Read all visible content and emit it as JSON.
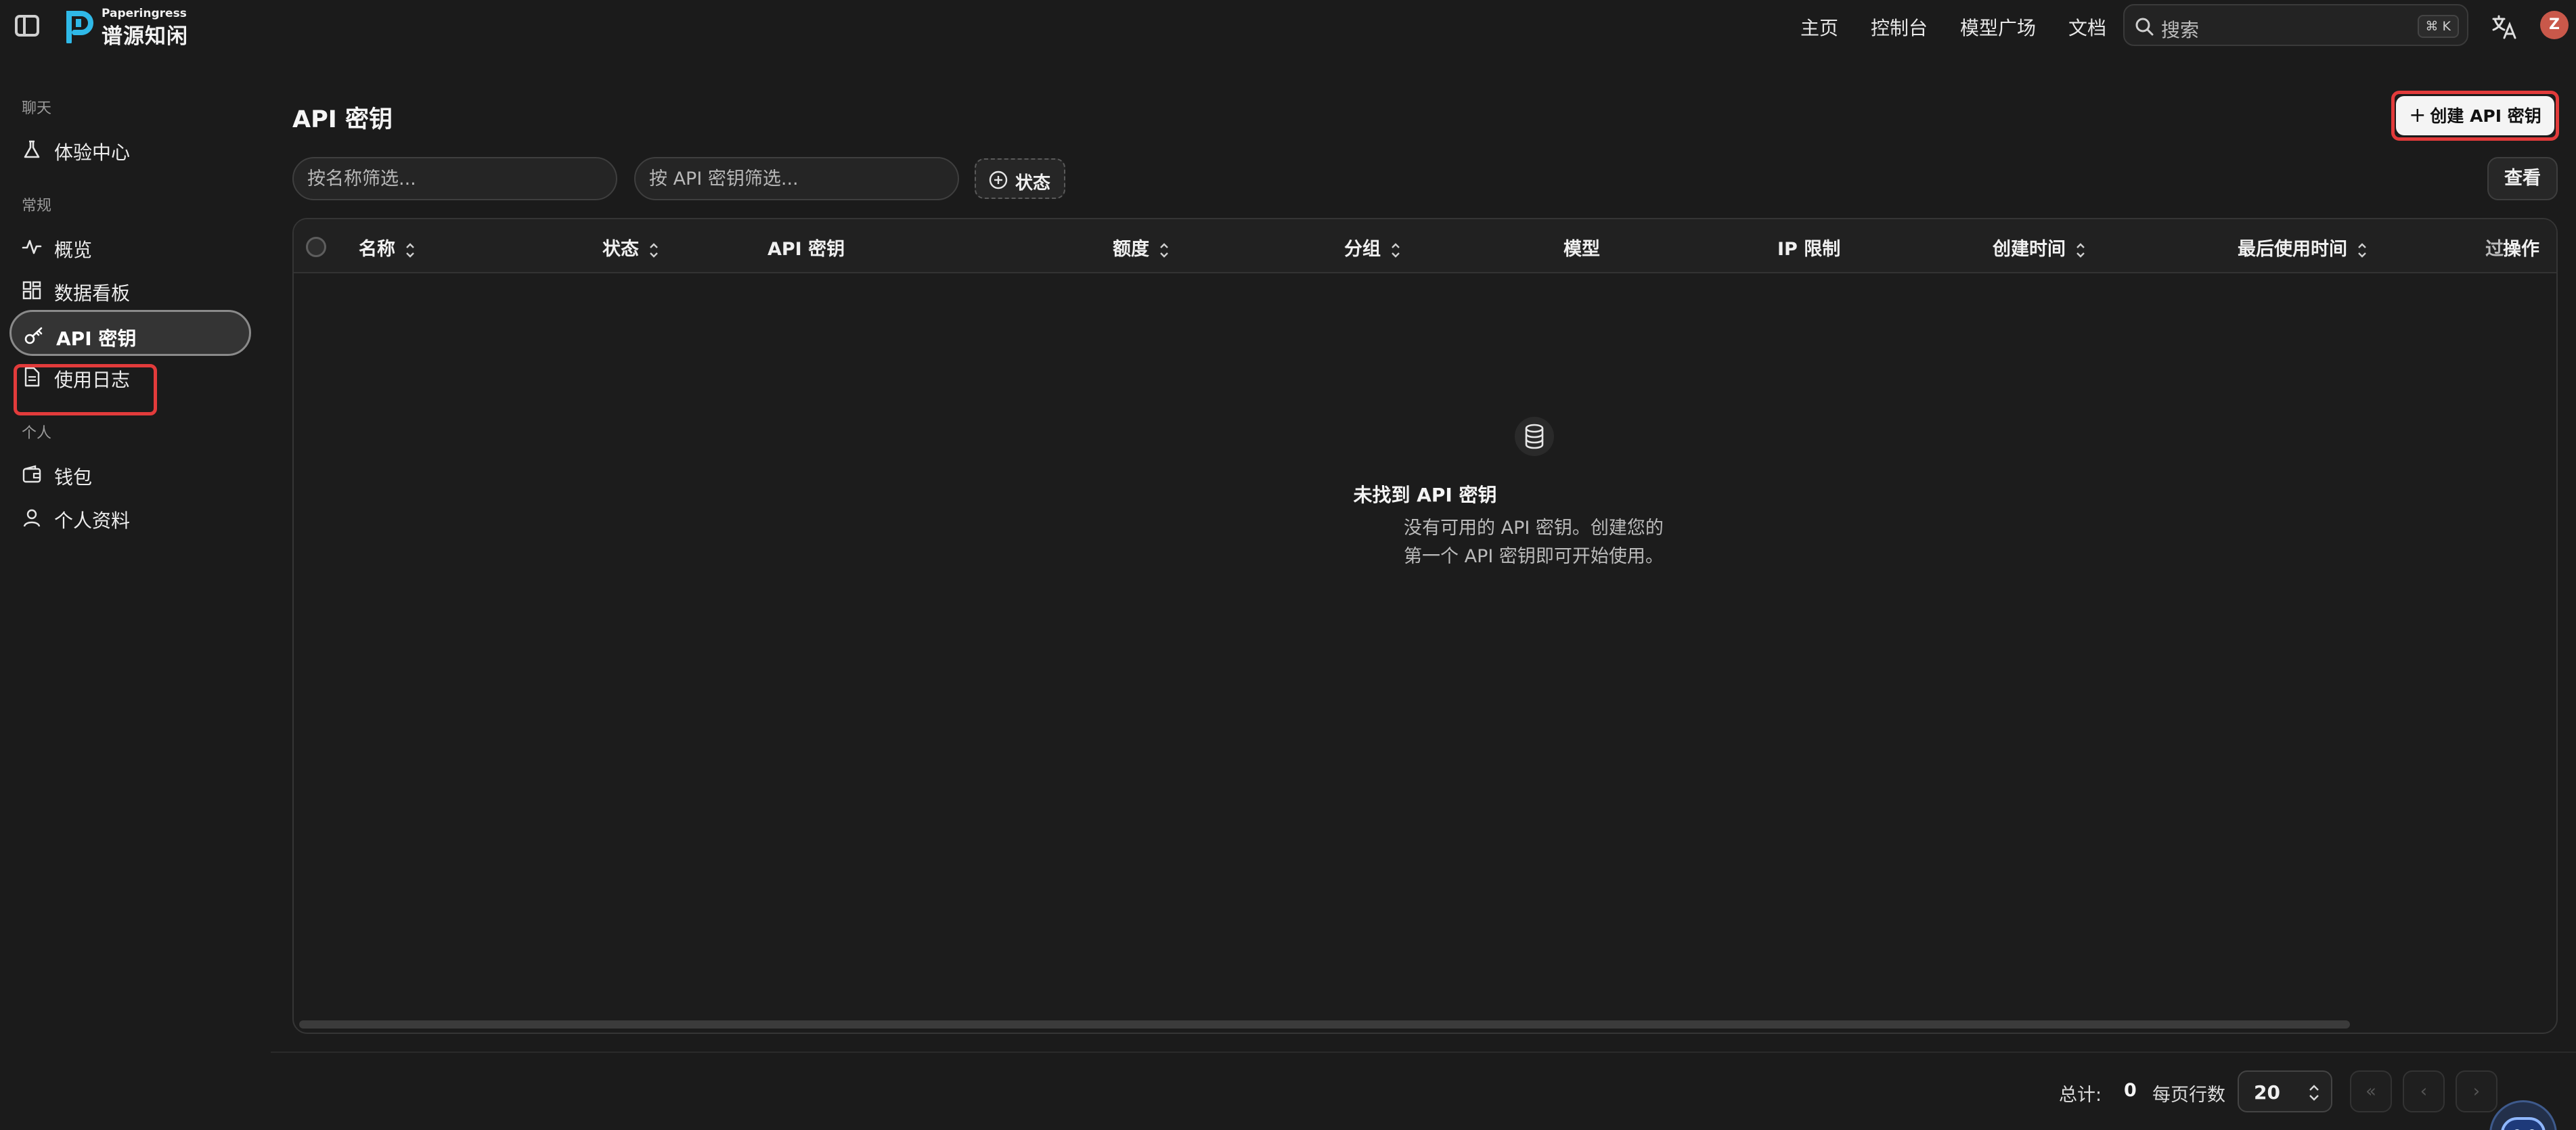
{
  "brand": {
    "small": "Paperingress",
    "name": "谱源知闲",
    "accent": "#2fb9e8"
  },
  "nav": {
    "home": "主页",
    "console": "控制台",
    "models": "模型广场",
    "docs": "文档"
  },
  "search": {
    "placeholder": "搜索",
    "shortcut": "⌘ K"
  },
  "user": {
    "avatar_letter": "Z",
    "avatar_color": "#c9584a"
  },
  "sidebar": {
    "sections": [
      {
        "title": "聊天",
        "items": [
          {
            "label": "体验中心",
            "icon": "flask-icon"
          }
        ]
      },
      {
        "title": "常规",
        "items": [
          {
            "label": "概览",
            "icon": "activity-icon"
          },
          {
            "label": "数据看板",
            "icon": "dashboard-icon"
          },
          {
            "label": "API 密钥",
            "icon": "key-icon",
            "active": true
          },
          {
            "label": "使用日志",
            "icon": "log-icon"
          }
        ]
      },
      {
        "title": "个人",
        "items": [
          {
            "label": "钱包",
            "icon": "wallet-icon"
          },
          {
            "label": "个人资料",
            "icon": "user-icon"
          }
        ]
      }
    ]
  },
  "page": {
    "title": "API 密钥",
    "create_button": "创建 API 密钥",
    "create_button_icon": "plus-icon",
    "view_button": "查看"
  },
  "filters": {
    "name_placeholder": "按名称筛选...",
    "key_placeholder": "按 API 密钥筛选...",
    "status_label": "状态"
  },
  "table": {
    "columns": [
      "名称",
      "状态",
      "API 密钥",
      "额度",
      "分组",
      "模型",
      "IP 限制",
      "创建时间",
      "最后使用时间",
      "操作"
    ],
    "partial_column": "过",
    "rows": []
  },
  "empty_state": {
    "icon": "database-icon",
    "title": "未找到 API 密钥",
    "line1": "没有可用的 API 密钥。创建您的",
    "line2": "第一个 API 密钥即可开始使用。"
  },
  "footer": {
    "total_label": "总计:",
    "total_value": "0",
    "rows_per_page_label": "每页行数",
    "rows_per_page_value": "20"
  },
  "highlight_color": "#e23b3b"
}
